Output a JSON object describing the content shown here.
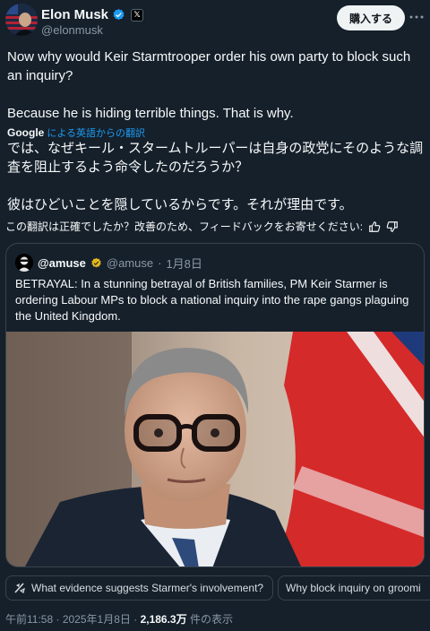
{
  "author": {
    "display_name": "Elon Musk",
    "handle": "@elonmusk",
    "affiliate_badge": "𝕏"
  },
  "subscribe_label": "購入する",
  "post": {
    "text": "Now why would Keir Starmtrooper order his own party to block such an inquiry?\n\nBecause he is hiding terrible things. That is why."
  },
  "translation": {
    "provider": "Google",
    "link_label": "による英語からの翻訳",
    "text": "では、なぜキール・スタームトルーパーは自身の政党にそのような調査を阻止するよう命令したのだろうか？\n\n彼はひどいことを隠しているからです。それが理由です。",
    "feedback_prompt": "この翻訳は正確でしたか？改善のため、フィードバックをお寄せください:"
  },
  "quote": {
    "name": "@amuse",
    "handle": "@amuse",
    "date": "1月8日",
    "separator": "·",
    "text": "BETRAYAL: In a stunning betrayal of British families, PM Keir Starmer is ordering Labour MPs to block a national inquiry into the rape gangs plaguing the United Kingdom."
  },
  "suggestions": [
    "What evidence suggests Starmer's involvement?",
    "Why block inquiry on groomi"
  ],
  "meta": {
    "time": "午前11:58",
    "date": "2025年1月8日",
    "separator": "·",
    "views": "2,186.3万",
    "views_suffix": "件の表示"
  },
  "colors": {
    "background": "#15202b",
    "accent": "#1d9bf0",
    "verified_gold": "#e2b719",
    "muted": "#8b98a5"
  },
  "icons": [
    "more-icon",
    "verified-icon",
    "gold-verified-icon",
    "thumbs-up-icon",
    "thumbs-down-icon",
    "grok-icon"
  ]
}
